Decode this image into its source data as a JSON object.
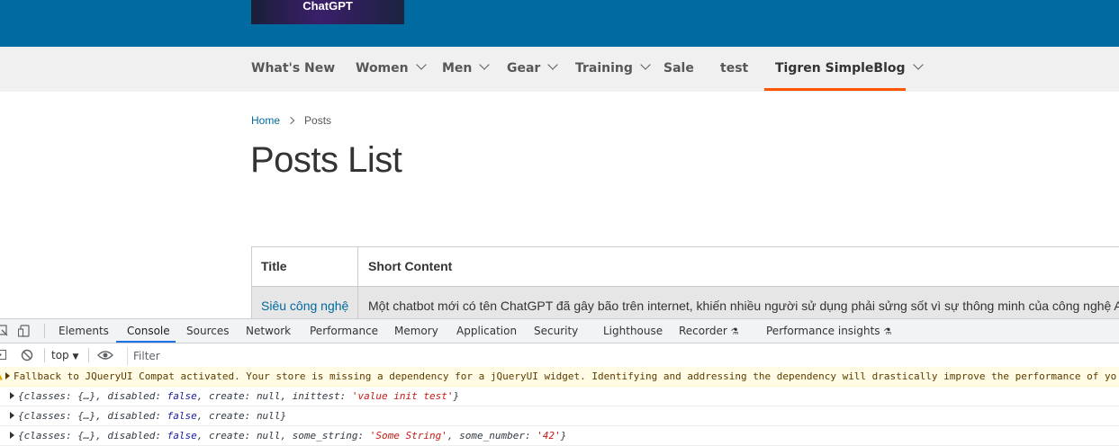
{
  "header": {
    "logo_text": "ChatGPT"
  },
  "nav": {
    "items": [
      {
        "label": "What's New",
        "has_dropdown": false
      },
      {
        "label": "Women",
        "has_dropdown": true
      },
      {
        "label": "Men",
        "has_dropdown": true
      },
      {
        "label": "Gear",
        "has_dropdown": true
      },
      {
        "label": "Training",
        "has_dropdown": true
      },
      {
        "label": "Sale",
        "has_dropdown": false
      },
      {
        "label": "test",
        "has_dropdown": false
      },
      {
        "label": "Tigren SimpleBlog",
        "has_dropdown": true,
        "active": true
      }
    ],
    "active_color": "#ff5501"
  },
  "breadcrumb": {
    "home": "Home",
    "current": "Posts"
  },
  "page": {
    "title": "Posts List"
  },
  "table": {
    "headers": [
      "Title",
      "Short Content"
    ],
    "rows": [
      {
        "title": "Siêu công nghệ",
        "short_content": "Một chatbot mới có tên ChatGPT đã gây bão trên internet, khiến nhiều người sử dụng phải sửng sốt vì sự thông minh của công nghệ A"
      }
    ]
  },
  "devtools": {
    "tabs": [
      "Elements",
      "Console",
      "Sources",
      "Network",
      "Performance",
      "Memory",
      "Application",
      "Security",
      "Lighthouse",
      "Recorder",
      "Performance insights"
    ],
    "active_tab": "Console",
    "context": "top",
    "filter_placeholder": "Filter",
    "warning": "Fallback to JQueryUI Compat activated. Your store is missing a dependency for a jQueryUI widget. Identifying and addressing the dependency will drastically improve the performance of yo",
    "logs": [
      {
        "prefix": "{classes: {…}, disabled: ",
        "disabled": "false",
        "mid": ", create: ",
        "create": "null",
        "extra_key": ", inittest: ",
        "extra_val": "'value init test'",
        "suffix": "}"
      },
      {
        "prefix": "{classes: {…}, disabled: ",
        "disabled": "false",
        "mid": ", create: ",
        "create": "null",
        "suffix": "}"
      },
      {
        "prefix": "{classes: {…}, disabled: ",
        "disabled": "false",
        "mid": ", create: ",
        "create": "null",
        "extra_key": ", some_string: ",
        "extra_val": "'Some String'",
        "extra_key2": ", some_number: ",
        "extra_val2": "'42'",
        "suffix": "}"
      }
    ]
  }
}
